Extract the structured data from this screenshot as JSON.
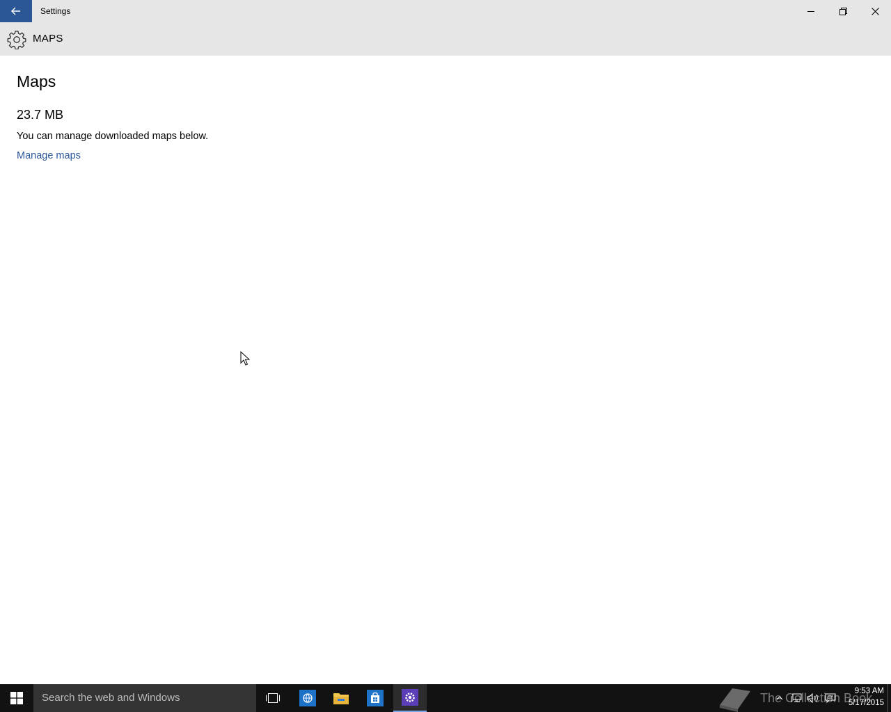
{
  "window": {
    "title": "Settings"
  },
  "header": {
    "section_title": "MAPS"
  },
  "main": {
    "heading": "Maps",
    "storage_size": "23.7 MB",
    "description": "You can manage downloaded maps below.",
    "manage_link": "Manage maps"
  },
  "taskbar": {
    "search_placeholder": "Search the web and Windows",
    "apps": [
      "task-view",
      "edge",
      "file-explorer",
      "store",
      "settings"
    ],
    "watermark": "The Collection Book",
    "time": "9:53 AM",
    "date": "5/17/2015"
  },
  "colors": {
    "accent": "#2b5797",
    "titlebar_bg": "#e6e6e6",
    "taskbar_bg": "#121212"
  }
}
